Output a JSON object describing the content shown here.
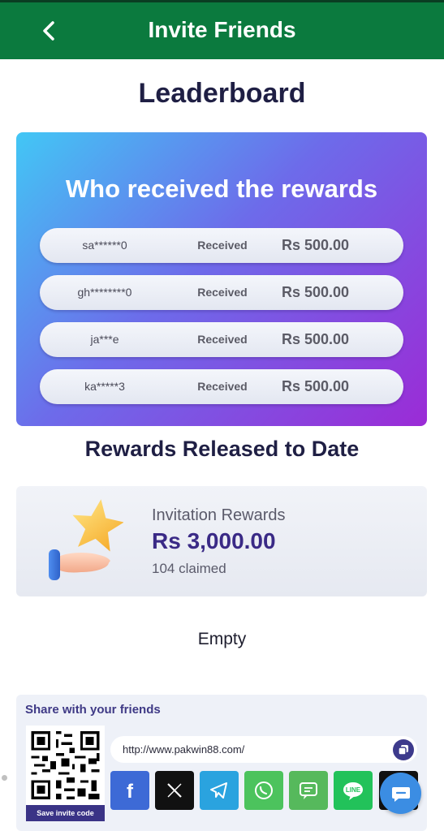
{
  "header": {
    "title": "Invite Friends"
  },
  "leaderboard": {
    "title": "Leaderboard",
    "card_title": "Who received the rewards",
    "rows": [
      {
        "name": "sa******0",
        "status": "Received",
        "amount": "Rs  500.00"
      },
      {
        "name": "gh********0",
        "status": "Received",
        "amount": "Rs  500.00"
      },
      {
        "name": "ja***e",
        "status": "Received",
        "amount": "Rs  500.00"
      },
      {
        "name": "ka*****3",
        "status": "Received",
        "amount": "Rs  500.00"
      }
    ]
  },
  "released": {
    "title": "Rewards Released to Date",
    "label": "Invitation Rewards",
    "amount": "Rs  3,000.00",
    "claimed": "104 claimed"
  },
  "empty_text": "Empty",
  "share": {
    "title": "Share with your friends",
    "save_label": "Save invite code",
    "url": "http://www.pakwin88.com/",
    "social": [
      {
        "icon": "facebook-icon",
        "color": "#3d6ad6"
      },
      {
        "icon": "x-icon",
        "color": "#111111"
      },
      {
        "icon": "telegram-icon",
        "color": "#2aa3df"
      },
      {
        "icon": "whatsapp-icon",
        "color": "#4cc35d"
      },
      {
        "icon": "sms-icon",
        "color": "#56b95c"
      },
      {
        "icon": "line-icon",
        "color": "#22c25a"
      },
      {
        "icon": "more-icon",
        "color": "#111111"
      }
    ]
  },
  "colors": {
    "header_bg": "#0b7a3e",
    "accent": "#3a2a86"
  }
}
